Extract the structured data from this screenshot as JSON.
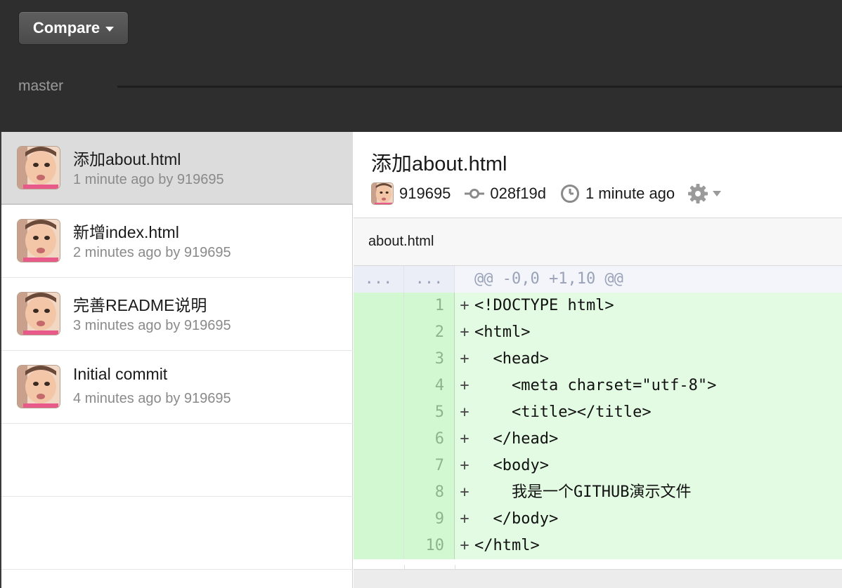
{
  "toolbar": {
    "compare_label": "Compare"
  },
  "branch": {
    "name": "master"
  },
  "commits": [
    {
      "title": "添加about.html",
      "meta": "1 minute ago by 919695",
      "selected": true
    },
    {
      "title": "新增index.html",
      "meta": "2 minutes ago by 919695",
      "selected": false
    },
    {
      "title": "完善README说明",
      "meta": "3 minutes ago by 919695",
      "selected": false
    },
    {
      "title": "Initial commit",
      "meta": "4 minutes ago by 919695",
      "selected": false
    }
  ],
  "detail": {
    "title": "添加about.html",
    "author": "919695",
    "sha": "028f19d",
    "time": "1 minute ago"
  },
  "file": {
    "name": "about.html"
  },
  "diff": {
    "hunk": {
      "old": "...",
      "new": "...",
      "header": "@@ -0,0 +1,10 @@"
    },
    "lines": [
      {
        "num": "1",
        "sign": "+",
        "code": "<!DOCTYPE html>"
      },
      {
        "num": "2",
        "sign": "+",
        "code": "<html>"
      },
      {
        "num": "3",
        "sign": "+",
        "code": "  <head>"
      },
      {
        "num": "4",
        "sign": "+",
        "code": "    <meta charset=\"utf-8\">"
      },
      {
        "num": "5",
        "sign": "+",
        "code": "    <title></title>"
      },
      {
        "num": "6",
        "sign": "+",
        "code": "  </head>"
      },
      {
        "num": "7",
        "sign": "+",
        "code": "  <body>"
      },
      {
        "num": "8",
        "sign": "+",
        "code": "    我是一个GITHUB演示文件"
      },
      {
        "num": "9",
        "sign": "+",
        "code": "  </body>"
      },
      {
        "num": "10",
        "sign": "+",
        "code": "</html>"
      }
    ]
  },
  "icons": {
    "dropdown": "caret-down-icon",
    "commit": "commit-icon",
    "clock": "clock-icon",
    "settings": "gear-icon"
  },
  "colors": {
    "topbar": "#2e2e2e",
    "selected_row": "#dcdcdc",
    "diff_added": "#e2fbe2",
    "diff_added_gutter": "#d2f8d2",
    "hunk_bg": "#f3f5fb"
  }
}
